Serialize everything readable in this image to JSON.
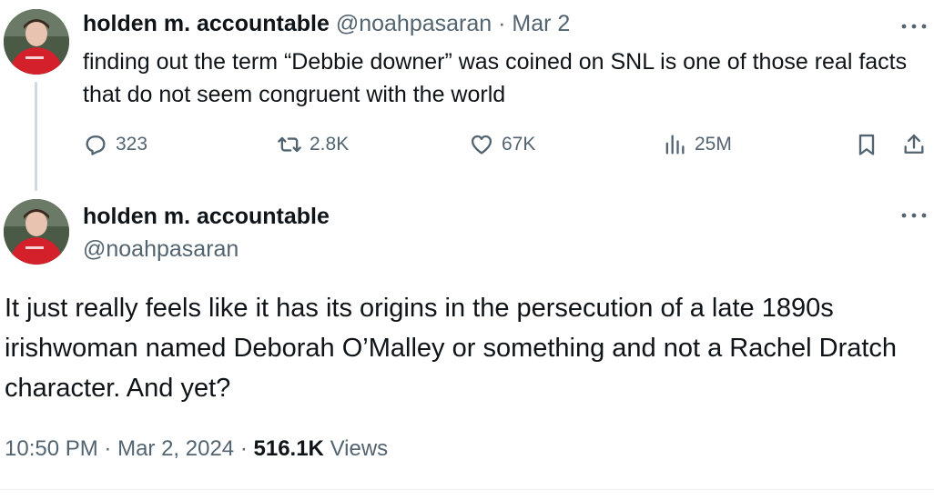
{
  "parent_tweet": {
    "display_name": "holden m. accountable",
    "handle": "@noahpasaran",
    "separator": "·",
    "date": "Mar 2",
    "text": "finding out the term “Debbie downer” was coined on SNL is one of those real facts that do not seem congruent with the world",
    "stats": {
      "replies": "323",
      "reposts": "2.8K",
      "likes": "67K",
      "views": "25M"
    }
  },
  "main_tweet": {
    "display_name": "holden m. accountable",
    "handle": "@noahpasaran",
    "text": "It just really feels like it has its origins in the persecution of a late 1890s irishwoman named Deborah O’Malley or something and not a Rachel Dratch character. And yet?",
    "time": "10:50 PM",
    "separator": "·",
    "date": "Mar 2, 2024",
    "views_count": "516.1K",
    "views_label": "Views"
  },
  "icons": {
    "reply": "reply-icon",
    "repost": "repost-icon",
    "like": "heart-icon",
    "views": "analytics-icon",
    "bookmark": "bookmark-icon",
    "share": "share-icon",
    "more": "more-dots-icon"
  },
  "colors": {
    "text_primary": "#0f1419",
    "text_secondary": "#536471",
    "thread_line": "#cfd9de",
    "avatar_shirt": "#d3202b"
  }
}
